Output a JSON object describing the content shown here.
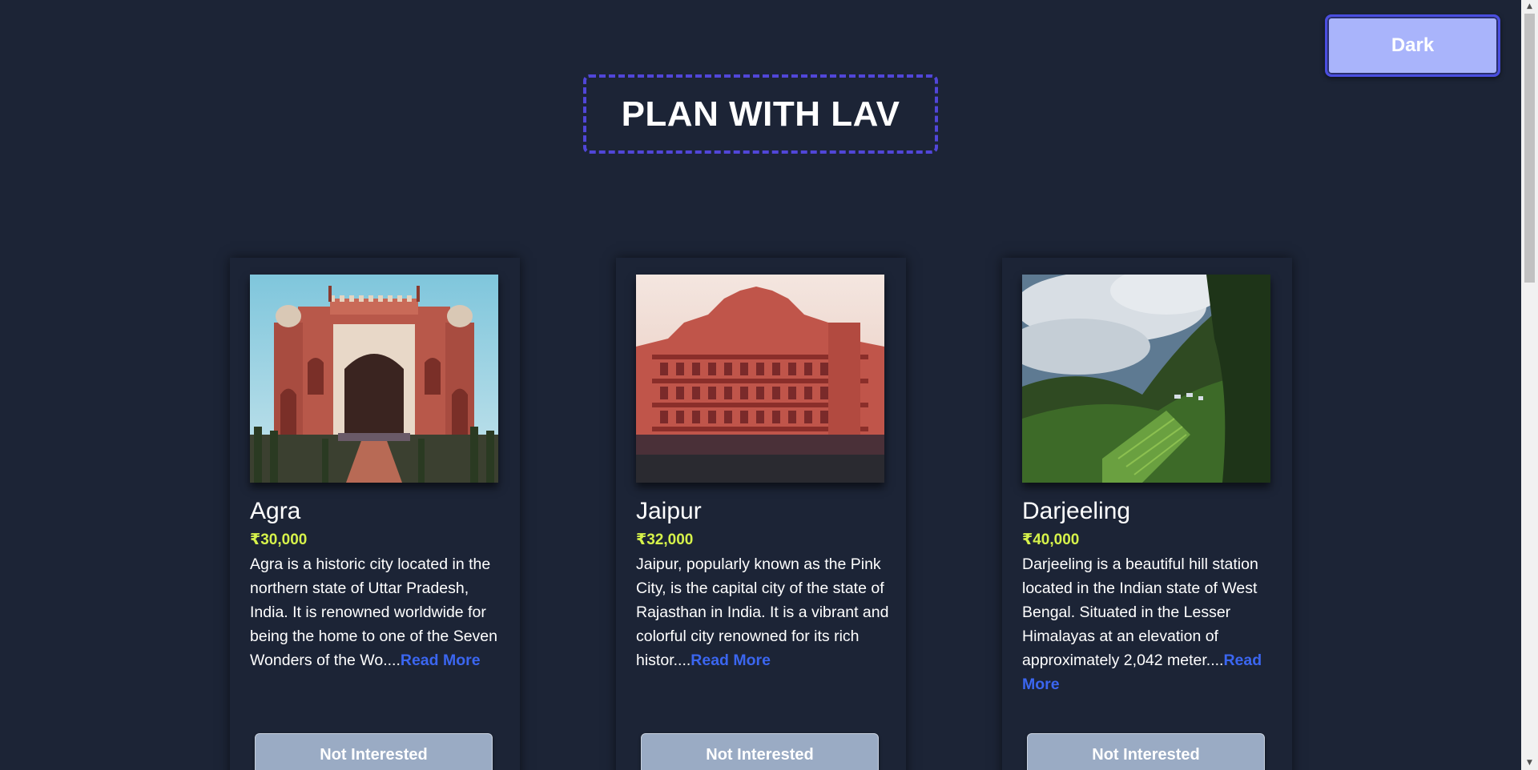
{
  "theme_toggle": {
    "label": "Dark"
  },
  "header": {
    "title": "PLAN WITH LAV"
  },
  "cards": [
    {
      "city": "Agra",
      "price": "₹30,000",
      "description": "Agra is a historic city located in the northern state of Uttar Pradesh, India. It is renowned worldwide for being the home to one of the Seven Wonders of the Wo....",
      "read_more": "Read More",
      "button": "Not Interested",
      "image_icon": "agra-gate-image"
    },
    {
      "city": "Jaipur",
      "price": "₹32,000",
      "description": "Jaipur, popularly known as the Pink City, is the capital city of the state of Rajasthan in India. It is a vibrant and colorful city renowned for its rich histor....",
      "read_more": "Read More",
      "button": "Not Interested",
      "image_icon": "hawa-mahal-image"
    },
    {
      "city": "Darjeeling",
      "price": "₹40,000",
      "description": "Darjeeling is a beautiful hill station located in the Indian state of West Bengal. Situated in the Lesser Himalayas at an elevation of approximately 2,042 meter....",
      "read_more": "Read More",
      "button": "Not Interested",
      "image_icon": "hill-station-image"
    }
  ],
  "colors": {
    "background": "#1c2436",
    "accent": "#5146d8",
    "price": "#d6f24a",
    "link": "#3b66f0",
    "toggle_bg": "#a9b4fb",
    "button_bg": "#9aabc4"
  }
}
